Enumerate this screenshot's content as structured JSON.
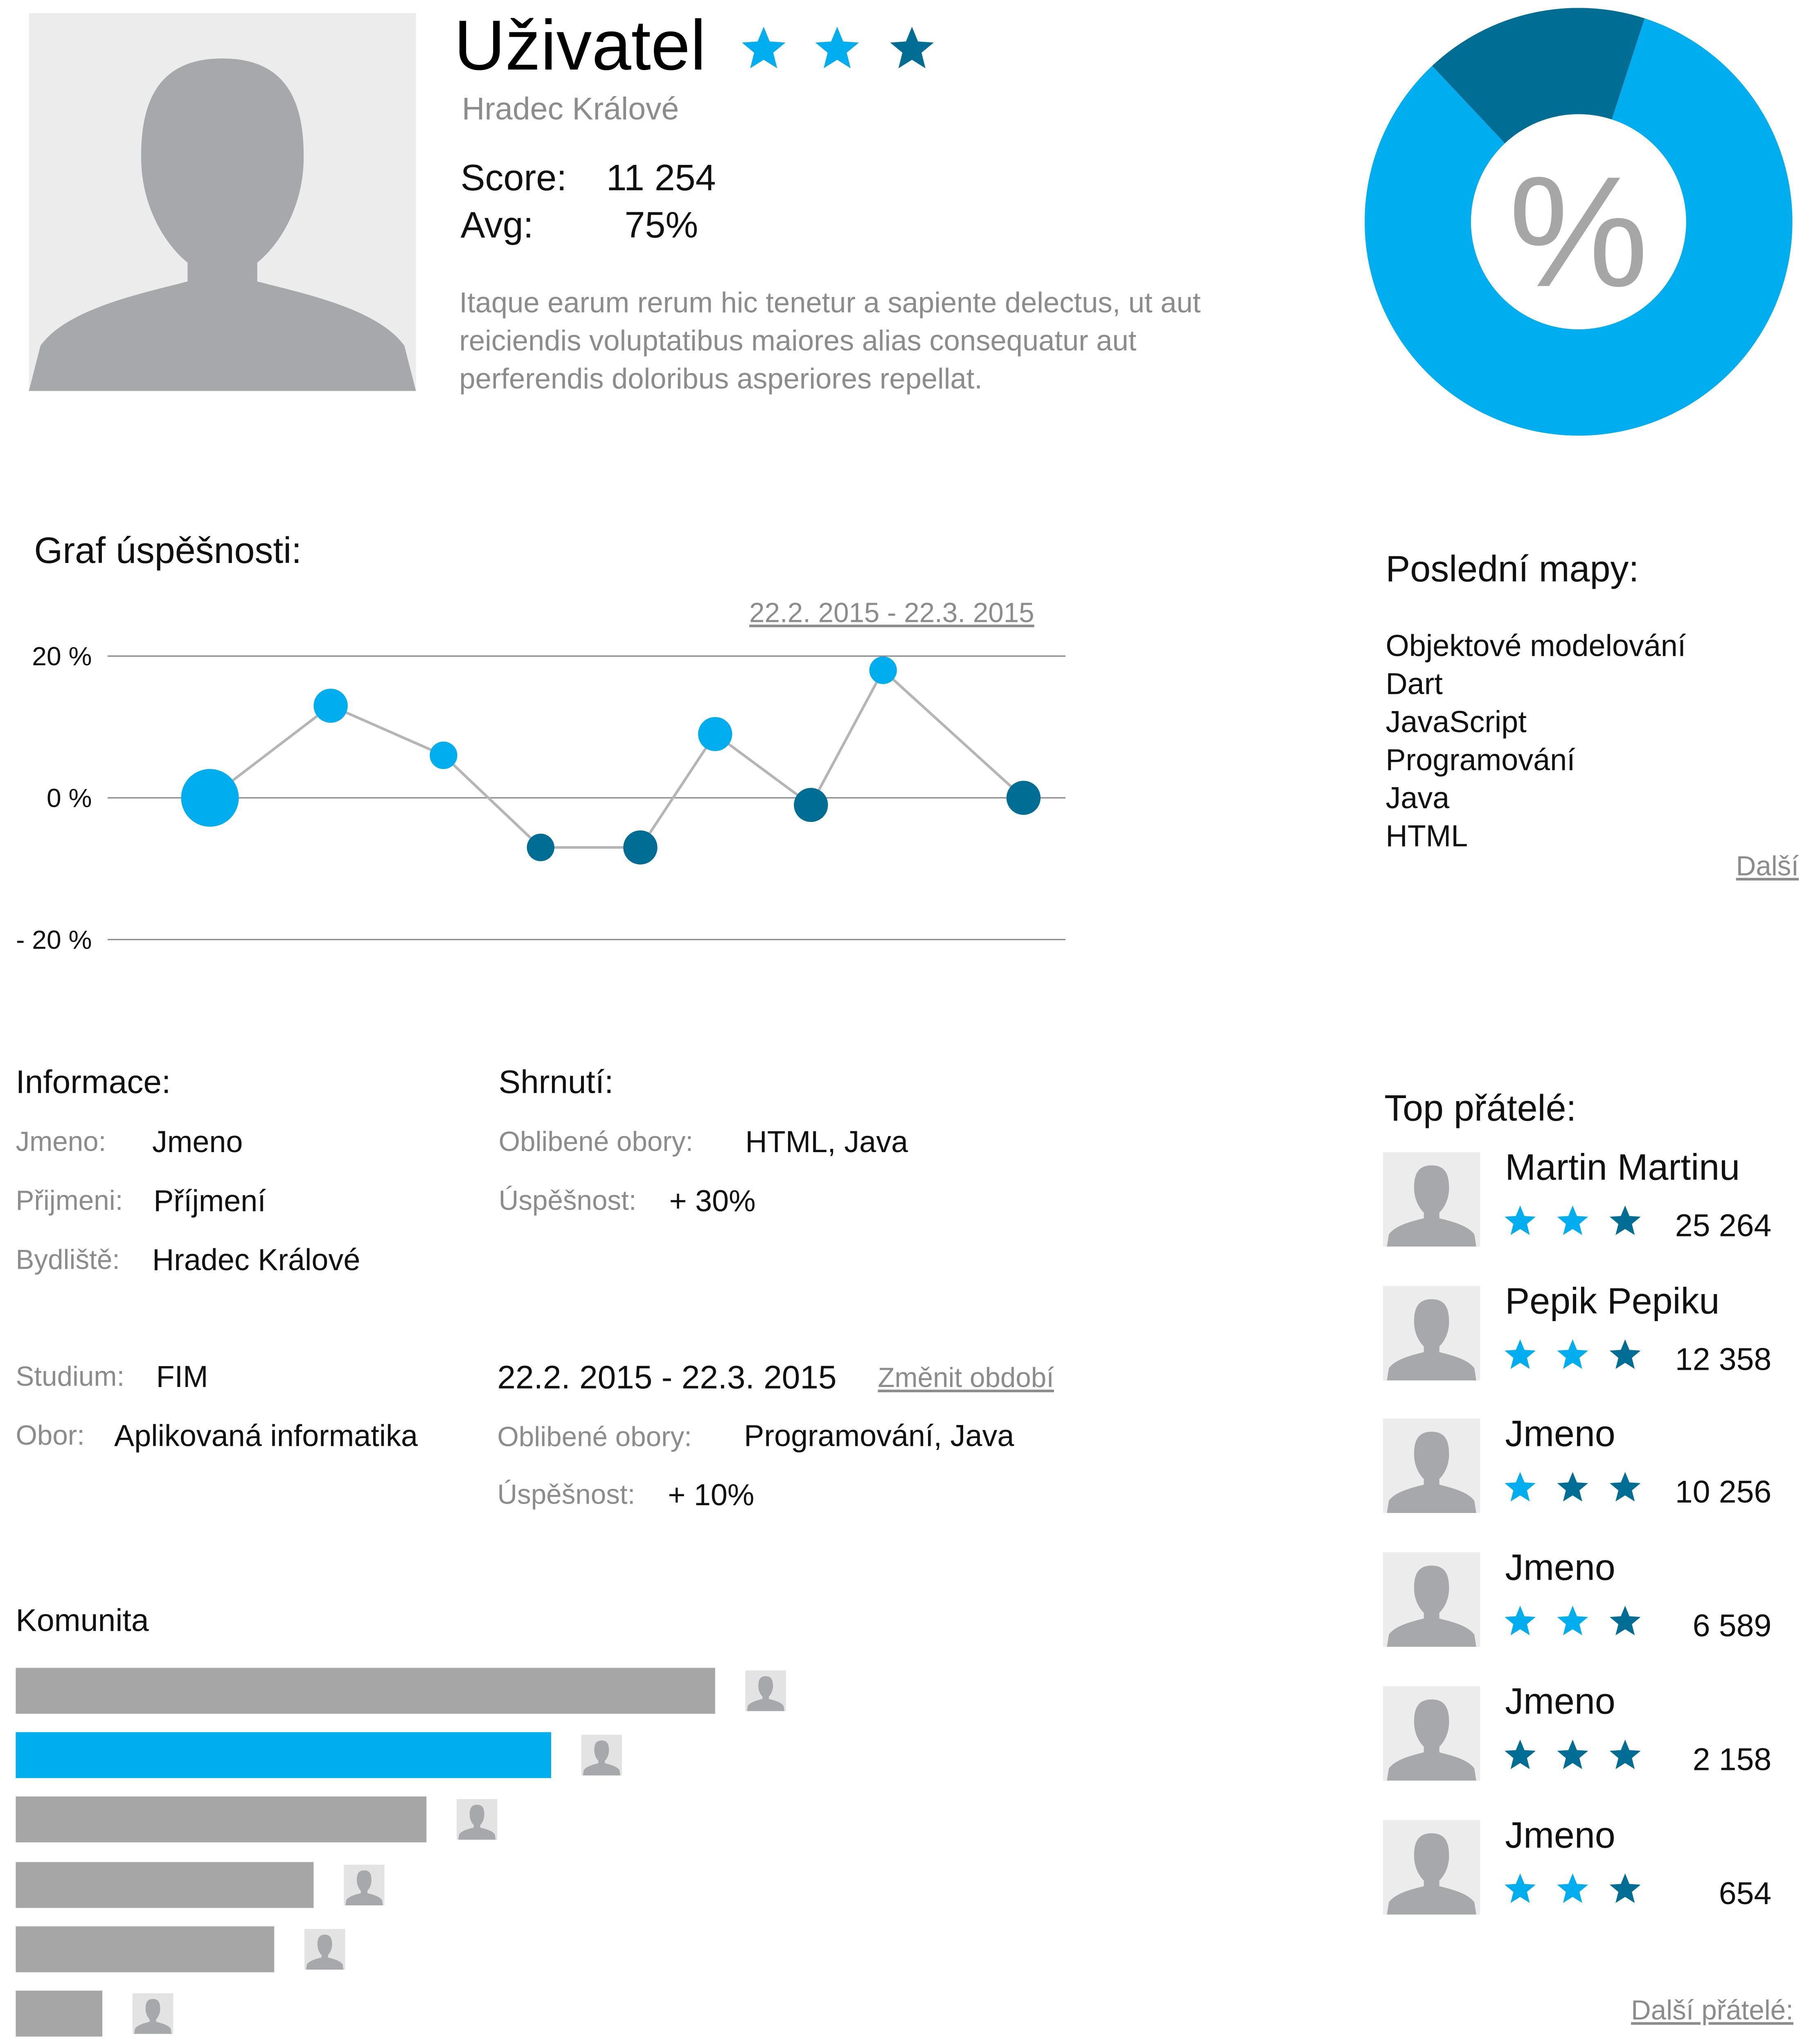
{
  "profile": {
    "name": "Uživatel",
    "city": "Hradec Králové",
    "stars": [
      "light",
      "light",
      "dark"
    ],
    "score_label": "Score:",
    "score_value": "11 254",
    "avg_label": "Avg:",
    "avg_value": "75%",
    "description": "Itaque earum rerum hic tenetur a sapiente delectus, ut aut reiciendis voluptatibus maiores alias consequatur aut perferendis doloribus asperiores repellat."
  },
  "donut": {
    "center_symbol": "%",
    "segments": [
      {
        "color": "#00adef",
        "fraction": 0.83
      },
      {
        "color": "#006e94",
        "fraction": 0.17
      }
    ]
  },
  "success_chart": {
    "heading": "Graf úspěšnosti:",
    "date_range_link": "22.2. 2015 - 22.3. 2015",
    "chart_data": {
      "type": "scatter",
      "title": "Graf úspěšnosti:",
      "xlabel": "",
      "ylabel": "",
      "y_tick_labels": [
        "20 %",
        "0 %",
        "- 20 %"
      ],
      "ylim": [
        -20,
        20
      ],
      "grid": true,
      "series": [
        {
          "values": [
            0,
            13,
            6,
            -7,
            -7,
            9,
            -1,
            18,
            0
          ],
          "point_sizes": [
            "large",
            "medium",
            "small",
            "small",
            "medium",
            "medium",
            "medium",
            "small",
            "medium"
          ],
          "point_colors": [
            "#00adef",
            "#00adef",
            "#00adef",
            "#006e94",
            "#006e94",
            "#00adef",
            "#006e94",
            "#00adef",
            "#006e94"
          ]
        }
      ],
      "line_color": "#b5b5b5"
    }
  },
  "recent_maps": {
    "heading": "Poslední mapy:",
    "items": [
      "Objektové modelování",
      "Dart",
      "JavaScript",
      "Programování",
      "Java",
      "HTML"
    ],
    "more_link": "Další"
  },
  "info": {
    "heading": "Informace:",
    "rows": [
      {
        "label": "Jmeno:",
        "value": "Jmeno"
      },
      {
        "label": "Přijmeni:",
        "value": "Příjmení"
      },
      {
        "label": "Bydliště:",
        "value": "Hradec Králové"
      }
    ],
    "study_rows": [
      {
        "label": "Studium:",
        "value": "FIM"
      },
      {
        "label": "Obor:",
        "value": "Aplikovaná informatika"
      }
    ]
  },
  "summary": {
    "heading": "Shrnutí:",
    "rows": [
      {
        "label": "Oblibené obory:",
        "value": "HTML, Java"
      },
      {
        "label": "Úspěšnost:",
        "value": "+ 30%"
      }
    ],
    "period": "22.2. 2015 - 22.3. 2015",
    "change_period_link": "Změnit období",
    "period_rows": [
      {
        "label": "Oblibené obory:",
        "value": "Programování, Java"
      },
      {
        "label": "Úspěšnost:",
        "value": "+ 10%"
      }
    ]
  },
  "community": {
    "heading": "Komunita",
    "bars": [
      {
        "value": 533,
        "color": "#a6a6a6"
      },
      {
        "value": 408,
        "color": "#00adef"
      },
      {
        "value": 313,
        "color": "#a6a6a6"
      },
      {
        "value": 227,
        "color": "#a6a6a6"
      },
      {
        "value": 197,
        "color": "#a6a6a6"
      },
      {
        "value": 66,
        "color": "#a6a6a6"
      }
    ]
  },
  "friends": {
    "heading": "Top přátelé:",
    "items": [
      {
        "name": "Martin Martinu",
        "score": "25 264",
        "stars": [
          "light",
          "light",
          "dark"
        ]
      },
      {
        "name": "Pepik Pepiku",
        "score": "12 358",
        "stars": [
          "light",
          "light",
          "dark"
        ]
      },
      {
        "name": "Jmeno",
        "score": "10 256",
        "stars": [
          "light",
          "dark",
          "dark"
        ]
      },
      {
        "name": "Jmeno",
        "score": "6 589",
        "stars": [
          "light",
          "light",
          "dark"
        ]
      },
      {
        "name": "Jmeno",
        "score": "2 158",
        "stars": [
          "dark",
          "dark",
          "dark"
        ]
      },
      {
        "name": "Jmeno",
        "score": "654",
        "stars": [
          "light",
          "light",
          "dark"
        ]
      }
    ],
    "more_link": "Další přátelé:"
  },
  "colors": {
    "light_blue": "#00adef",
    "dark_blue": "#006e94",
    "gray_text": "#8c8c8c",
    "gray_bar": "#a6a6a6"
  }
}
